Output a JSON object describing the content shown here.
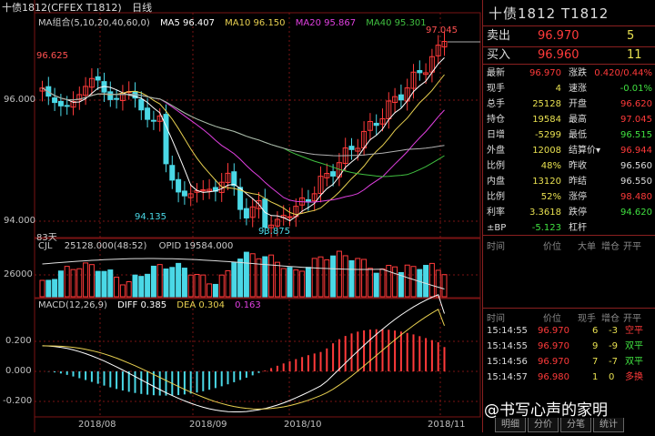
{
  "header": {
    "title": "十债1812(CFFEX T1812)",
    "period": "日线",
    "ma_label": "MA组合(5,10,20,40,60,0)",
    "ma5": "MA5 96.407",
    "ma10": "MA10 96.150",
    "ma20": "MA20 95.867",
    "ma40": "MA40 95.301"
  },
  "colors": {
    "up": "#ff3a3a",
    "down": "#4ad8e6",
    "ma5": "#ffffff",
    "ma10": "#e8d050",
    "ma20": "#e040e0",
    "ma40": "#40c040",
    "ma60": "#b0b0b0",
    "grid": "#7a1414"
  },
  "price_panel": {
    "y_ticks": [
      "96.000",
      "94.000"
    ],
    "annotations": {
      "high_left": "96.625",
      "low_a": "94.135",
      "low_b": "93.875",
      "high_right": "97.045",
      "days": "83天"
    }
  },
  "volume_panel": {
    "label": "CJL",
    "values": "25128.000(48:52)",
    "opid": "OPID 19584.000",
    "y_tick": "26000"
  },
  "macd_panel": {
    "label": "MACD(12,26,9)",
    "diff": "DIFF 0.385",
    "dea": "DEA 0.304",
    "macd": "0.163",
    "y_ticks": [
      "0.200",
      "0.000",
      "-0.200"
    ]
  },
  "x_axis": [
    "2018/08",
    "2018/09",
    "2018/10",
    "2018/11"
  ],
  "sidebar": {
    "title": "十债1812  T1812",
    "sell_label": "卖出",
    "sell_price": "96.970",
    "sell_qty": "5",
    "buy_label": "买入",
    "buy_price": "96.960",
    "buy_qty": "11",
    "stats": [
      {
        "l1": "最新",
        "v1": "96.970",
        "c1": "#ff3a3a",
        "l2": "涨跌",
        "v2": "0.420/0.44%",
        "c2": "#ff3a3a"
      },
      {
        "l1": "现手",
        "v1": "4",
        "c1": "#e8e050",
        "l2": "速涨",
        "v2": "-0.01%",
        "c2": "#40e040"
      },
      {
        "l1": "总手",
        "v1": "25128",
        "c1": "#e8e050",
        "l2": "开盘",
        "v2": "96.620",
        "c2": "#ff3a3a"
      },
      {
        "l1": "持仓",
        "v1": "19584",
        "c1": "#e8e050",
        "l2": "最高",
        "v2": "97.045",
        "c2": "#ff3a3a"
      },
      {
        "l1": "日增",
        "v1": "-5299",
        "c1": "#e8e050",
        "l2": "最低",
        "v2": "96.515",
        "c2": "#40e040"
      },
      {
        "l1": "外盘",
        "v1": "12008",
        "c1": "#e8e050",
        "l2": "结算价▾",
        "v2": "96.944",
        "c2": "#ff3a3a"
      },
      {
        "l1": "比例",
        "v1": "48%",
        "c1": "#e8e050",
        "l2": "昨收",
        "v2": "96.560",
        "c2": "#dddddd"
      },
      {
        "l1": "内盘",
        "v1": "13120",
        "c1": "#e8e050",
        "l2": "昨结",
        "v2": "96.550",
        "c2": "#dddddd"
      },
      {
        "l1": "比例",
        "v1": "52%",
        "c1": "#e8e050",
        "l2": "涨停",
        "v2": "98.480",
        "c2": "#ff3a3a"
      },
      {
        "l1": "利率",
        "v1": "3.3618",
        "c1": "#e8e050",
        "l2": "跌停",
        "v2": "94.620",
        "c2": "#40e040"
      },
      {
        "l1": "±BP",
        "v1": "-5.123",
        "c1": "#40e040",
        "l2": "杠杆",
        "v2": "",
        "c2": "#dddddd"
      }
    ],
    "upper_headers": [
      "时间",
      "价位",
      "大单",
      "增仓",
      "开平"
    ],
    "lower_headers": [
      "时间",
      "价位",
      "现手",
      "增仓",
      "开平"
    ],
    "trades": [
      {
        "time": "15:14:55",
        "price": "96.970",
        "qty": "6",
        "inc": "-3",
        "type": "空平",
        "color": "#ff3a3a"
      },
      {
        "time": "15:14:55",
        "price": "96.970",
        "qty": "9",
        "inc": "-9",
        "type": "双平",
        "color": "#40e040"
      },
      {
        "time": "15:14:56",
        "price": "96.970",
        "qty": "7",
        "inc": "-7",
        "type": "双平",
        "color": "#40e040"
      },
      {
        "time": "15:14:57",
        "price": "96.980",
        "qty": "1",
        "inc": "0",
        "type": "多换",
        "color": "#ff3a3a"
      }
    ],
    "tabs": [
      "明细",
      "分价",
      "分笔",
      "统计"
    ]
  },
  "watermark": "@书写心声的家明"
}
